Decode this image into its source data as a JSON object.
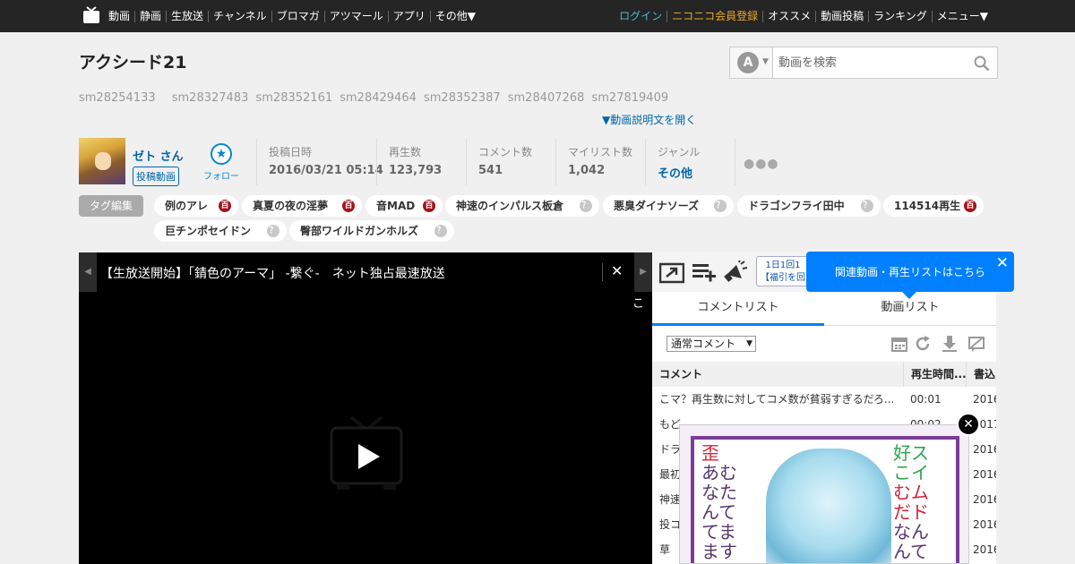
{
  "nav": {
    "left": [
      "動画",
      "静画",
      "生放送",
      "チャンネル",
      "ブロマガ",
      "アツマール",
      "アプリ",
      "その他▼"
    ],
    "right": [
      "ログイン",
      "ニコニコ会員登録",
      "オススメ",
      "動画投稿",
      "ランキング",
      "メニュー▼"
    ]
  },
  "video": {
    "title": "アクシード21",
    "description_ids": [
      "sm28254133",
      "sm28327483",
      "sm28352161",
      "sm28429464",
      "sm28352387",
      "sm28407268",
      "sm27819409"
    ],
    "description_toggle": "▼動画説明文を開く"
  },
  "search": {
    "mode": "A",
    "mode_arrow": "▼",
    "placeholder": "動画を検索"
  },
  "uploader": {
    "name": "ゼト さん",
    "videos_link": "投稿動画",
    "follow_label": "フォロー"
  },
  "stats": [
    {
      "label": "投稿日時",
      "value": "2016/03/21 05:14"
    },
    {
      "label": "再生数",
      "value": "123,793"
    },
    {
      "label": "コメント数",
      "value": "541"
    },
    {
      "label": "マイリスト数",
      "value": "1,042"
    },
    {
      "label": "ジャンル",
      "value": "その他"
    }
  ],
  "tags": {
    "edit_label": "タグ編集",
    "items": [
      {
        "name": "例のアレ",
        "badge": "百"
      },
      {
        "name": "真夏の夜の淫夢",
        "badge": "百"
      },
      {
        "name": "音MAD",
        "badge": "百"
      },
      {
        "name": "神速のインパルス板倉",
        "badge": "？"
      },
      {
        "name": "悪臭ダイナソーズ",
        "badge": "？"
      },
      {
        "name": "ドラゴンフライ田中",
        "badge": "？"
      },
      {
        "name": "114514再生",
        "badge": "百"
      },
      {
        "name": "巨チンポセイドン",
        "badge": "？"
      },
      {
        "name": "臀部ワイルドガンホルズ",
        "badge": "？"
      }
    ]
  },
  "player": {
    "prev_arrow": "◀",
    "next_arrow": "▶",
    "notice": "【生放送開始】「錆色のアーマ」 -繋ぐ-　ネット独占最速放送",
    "notice_close": "✕",
    "comment_glyph": "こ"
  },
  "side": {
    "ad_lines": [
      "1日1回1",
      "【福引を回"
    ],
    "tabs": [
      "コメントリスト",
      "動画リスト"
    ],
    "comment_filter": "通常コメント",
    "comment_filter_arrow": "▼",
    "columns": [
      "コメント",
      "再生時間...",
      "書込"
    ],
    "rows": [
      {
        "comment": "こマ？再生数に対してコメ数が貧弱すぎるだろ...",
        "time": "00:01",
        "date": "2016"
      },
      {
        "comment": "もど...",
        "time": "00:02",
        "date": "2017"
      },
      {
        "comment": "ドラ",
        "time": "",
        "date": "2016"
      },
      {
        "comment": "最初",
        "time": "",
        "date": "2016"
      },
      {
        "comment": "神速",
        "time": "",
        "date": "2016"
      },
      {
        "comment": "投コ",
        "time": "",
        "date": "2016"
      },
      {
        "comment": "草",
        "time": "",
        "date": "2016"
      }
    ]
  },
  "balloon": {
    "text": "関連動画・再生リストはこちら",
    "close": "✕"
  },
  "overlay_ad": {
    "close": "✕",
    "left_lines": [
      "歪",
      "あむ",
      "なた",
      "んて",
      "てま",
      "ます"
    ],
    "right_lines": [
      "好ス",
      "こイ",
      "むム",
      "だド",
      "なん",
      "んて"
    ]
  },
  "colors": {
    "nav_bg": "#252525",
    "accent_blue": "#0080ff",
    "link_blue": "#0066aa",
    "login": "#4dbbd4",
    "premium": "#e8a72b",
    "tag_badge": "#a3131b"
  }
}
